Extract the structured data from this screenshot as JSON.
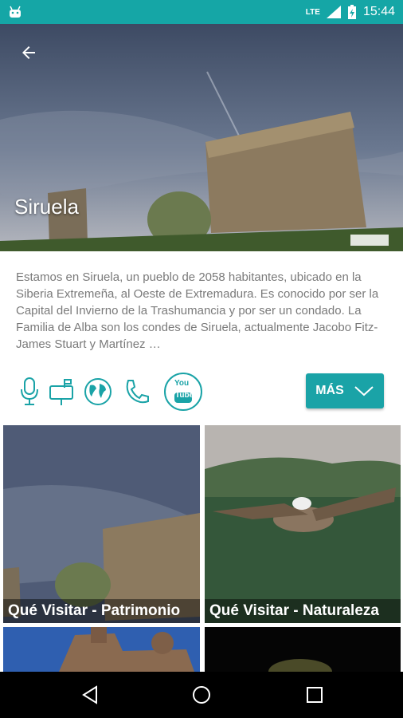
{
  "status_bar": {
    "time": "15:44",
    "network": "LTE",
    "app_icon": "android-icon",
    "accent": "#15a6a6"
  },
  "hero": {
    "title": "Siruela",
    "back_icon": "arrow-back-icon"
  },
  "description": "Estamos en Siruela, un pueblo de 2058 habitantes, ubicado en la Siberia Extremeña, al Oeste de Extremadura. Es conocido por ser la Capital del Invierno de la Trashumancia y por ser un condado. La Familia de Alba son los condes de Siruela, actualmente Jacobo Fitz-James Stuart y Martínez …",
  "actions": {
    "icons": [
      "microphone-icon",
      "mailbox-icon",
      "globe-icon",
      "phone-icon",
      "youtube-icon"
    ],
    "youtube_top": "You",
    "youtube_bottom": "Tube",
    "more_button": "MÁS",
    "accent": "#1aa3a7"
  },
  "tiles": [
    {
      "caption": "Qué Visitar - Patrimonio"
    },
    {
      "caption": "Qué Visitar - Naturaleza"
    },
    {
      "caption": ""
    },
    {
      "caption": ""
    }
  ],
  "nav": {
    "back": "nav-back-icon",
    "home": "nav-home-icon",
    "recents": "nav-recents-icon"
  }
}
